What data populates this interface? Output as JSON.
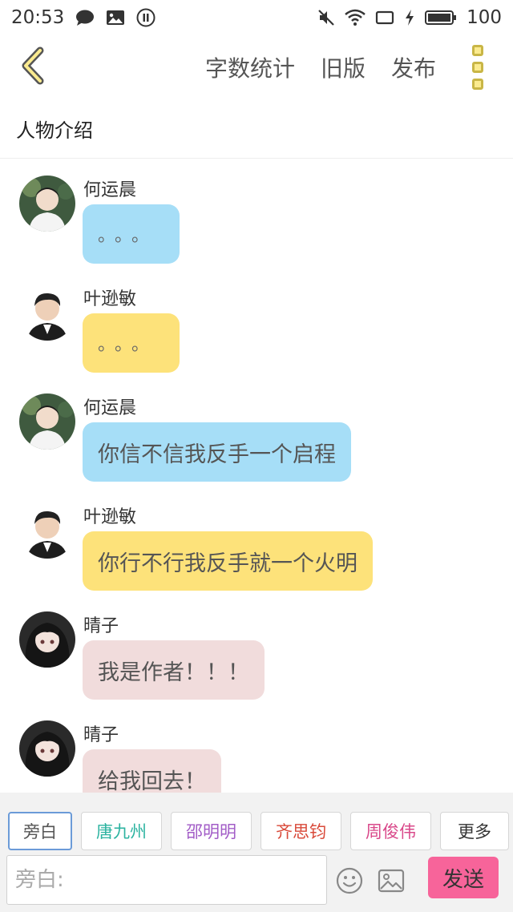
{
  "status_bar": {
    "time": "20:53",
    "battery": "100",
    "icons": [
      "chat-bubble-icon",
      "image-icon",
      "pause-icon",
      "mute-icon",
      "wifi-icon",
      "screen-icon",
      "charging-icon",
      "battery-icon"
    ]
  },
  "toolbar": {
    "back_icon": "chevron-left-icon",
    "actions": [
      "字数统计",
      "旧版",
      "发布"
    ],
    "menu_icon": "more-vertical-icon",
    "accent": "#fbeb8f"
  },
  "section_title": "人物介绍",
  "messages": [
    {
      "sender": "何运晨",
      "text": "。。。",
      "color": "blue",
      "avatar": "avatar-heyunchen"
    },
    {
      "sender": "叶逊敏",
      "text": "。。。",
      "color": "yellow",
      "avatar": "avatar-yexunmin"
    },
    {
      "sender": "何运晨",
      "text": "你信不信我反手一个启程",
      "color": "blue",
      "avatar": "avatar-heyunchen"
    },
    {
      "sender": "叶逊敏",
      "text": "你行不行我反手就一个火明",
      "color": "yellow",
      "avatar": "avatar-yexunmin"
    },
    {
      "sender": "晴子",
      "text": "我是作者！！！",
      "color": "pink",
      "avatar": "avatar-qingzi"
    },
    {
      "sender": "晴子",
      "text": "给我回去！",
      "color": "pink",
      "avatar": "avatar-qingzi"
    }
  ],
  "character_chips": [
    {
      "label": "旁白",
      "color": "#555555",
      "active": true
    },
    {
      "label": "唐九州",
      "color": "#2cb3a0"
    },
    {
      "label": "邵明明",
      "color": "#a25cc7"
    },
    {
      "label": "齐思钧",
      "color": "#d94a3a"
    },
    {
      "label": "周俊伟",
      "color": "#d9488a"
    },
    {
      "label": "更多",
      "color": "#333333"
    }
  ],
  "composer": {
    "placeholder": "旁白:",
    "value": "",
    "emoji_icon": "emoji-icon",
    "image_icon": "image-icon",
    "send_label": "发送",
    "send_color": "#f7649a"
  },
  "colors": {
    "bubble_blue": "#a6def7",
    "bubble_yellow": "#fde27a",
    "bubble_pink": "#f1dcdc"
  }
}
